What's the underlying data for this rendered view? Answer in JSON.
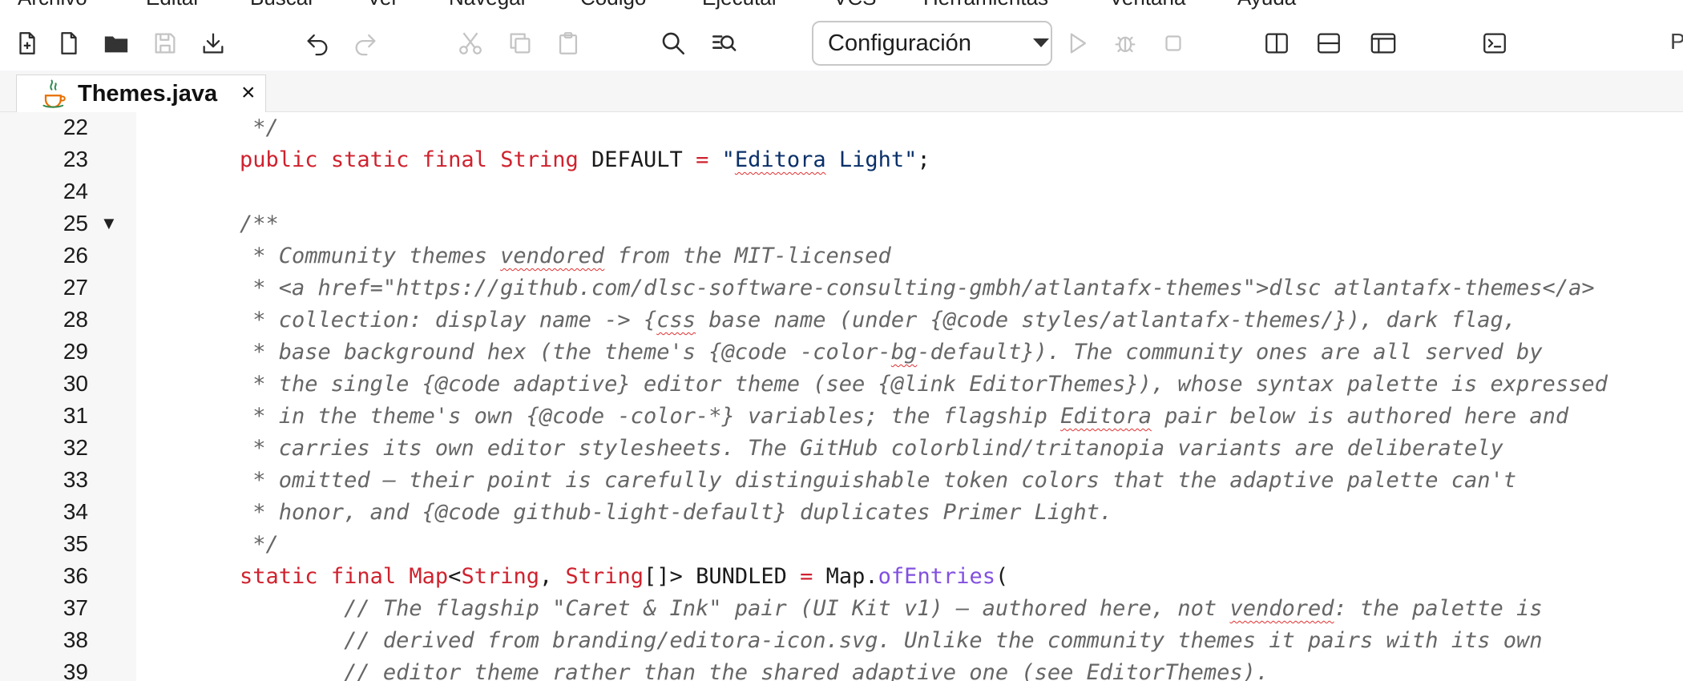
{
  "menubar": {
    "items": [
      "Archivo",
      "Editar",
      "Buscar",
      "Ver",
      "Navegar",
      "Código",
      "Ejecutar",
      "VCS",
      "Herramientas",
      "Ventana",
      "Ayuda"
    ]
  },
  "toolbar": {
    "buttons": [
      {
        "name": "new-file-icon",
        "enabled": true
      },
      {
        "name": "new-blank-file-icon",
        "enabled": true
      },
      {
        "name": "open-folder-icon",
        "enabled": true
      },
      {
        "name": "save-icon",
        "enabled": false
      },
      {
        "name": "download-icon",
        "enabled": true
      },
      {
        "name": "undo-icon",
        "enabled": true
      },
      {
        "name": "redo-icon",
        "enabled": false
      },
      {
        "name": "cut-icon",
        "enabled": false
      },
      {
        "name": "copy-icon",
        "enabled": false
      },
      {
        "name": "paste-icon",
        "enabled": false
      },
      {
        "name": "search-icon",
        "enabled": true
      },
      {
        "name": "search-replace-icon",
        "enabled": true
      },
      {
        "name": "run-icon",
        "enabled": false
      },
      {
        "name": "debug-icon",
        "enabled": false
      },
      {
        "name": "stop-icon",
        "enabled": false
      },
      {
        "name": "split-vertical-icon",
        "enabled": true
      },
      {
        "name": "split-horizontal-icon",
        "enabled": true
      },
      {
        "name": "layout-icon",
        "enabled": true
      },
      {
        "name": "terminal-icon",
        "enabled": true
      }
    ],
    "config_select": {
      "value": "Configuración"
    },
    "overflow_label": "P"
  },
  "tabs": [
    {
      "title": "Themes.java",
      "close": "×",
      "icon": "java-icon",
      "active": true
    }
  ],
  "editor": {
    "language": "java",
    "lines": [
      {
        "n": "22",
        "fold": "",
        "tokens": [
          {
            "t": "     */",
            "c": "cm"
          }
        ]
      },
      {
        "n": "23",
        "fold": "",
        "tokens": [
          {
            "t": "    ",
            "c": ""
          },
          {
            "t": "public",
            "c": "kw"
          },
          {
            "t": " ",
            "c": ""
          },
          {
            "t": "static",
            "c": "kw"
          },
          {
            "t": " ",
            "c": ""
          },
          {
            "t": "final",
            "c": "kw"
          },
          {
            "t": " ",
            "c": ""
          },
          {
            "t": "String",
            "c": "ty"
          },
          {
            "t": " DEFAULT ",
            "c": ""
          },
          {
            "t": "=",
            "c": "op"
          },
          {
            "t": " \"",
            "c": "str"
          },
          {
            "t": "Editora",
            "c": "str squig"
          },
          {
            "t": " Light\"",
            "c": "str"
          },
          {
            "t": ";",
            "c": ""
          }
        ]
      },
      {
        "n": "24",
        "fold": "",
        "tokens": []
      },
      {
        "n": "25",
        "fold": "▼",
        "tokens": [
          {
            "t": "    /**",
            "c": "cm"
          }
        ]
      },
      {
        "n": "26",
        "fold": "",
        "tokens": [
          {
            "t": "     * Community themes ",
            "c": "cm"
          },
          {
            "t": "vendored",
            "c": "cm squig"
          },
          {
            "t": " from the MIT-licensed",
            "c": "cm"
          }
        ]
      },
      {
        "n": "27",
        "fold": "",
        "tokens": [
          {
            "t": "     * <a href=\"https://github.com/dlsc-software-consulting-gmbh/atlantafx-themes\">dlsc atlantafx-themes</a>",
            "c": "cm"
          }
        ]
      },
      {
        "n": "28",
        "fold": "",
        "tokens": [
          {
            "t": "     * collection: display name -> {",
            "c": "cm"
          },
          {
            "t": "css",
            "c": "cm squig"
          },
          {
            "t": " base name (under {@code styles/atlantafx-themes/}), dark flag,",
            "c": "cm"
          }
        ]
      },
      {
        "n": "29",
        "fold": "",
        "tokens": [
          {
            "t": "     * base background hex (the theme's {@code -color-",
            "c": "cm"
          },
          {
            "t": "bg",
            "c": "cm squig"
          },
          {
            "t": "-default}). The community ones are all served by",
            "c": "cm"
          }
        ]
      },
      {
        "n": "30",
        "fold": "",
        "tokens": [
          {
            "t": "     * the single {@code adaptive} editor theme (see {@link EditorThemes}), whose syntax palette is expressed",
            "c": "cm"
          }
        ]
      },
      {
        "n": "31",
        "fold": "",
        "tokens": [
          {
            "t": "     * in the theme's own {@code -color-*} variables; the flagship ",
            "c": "cm"
          },
          {
            "t": "Editora",
            "c": "cm squig"
          },
          {
            "t": " pair below is authored here and",
            "c": "cm"
          }
        ]
      },
      {
        "n": "32",
        "fold": "",
        "tokens": [
          {
            "t": "     * carries its own editor stylesheets. The GitHub colorblind/tritanopia variants are deliberately",
            "c": "cm"
          }
        ]
      },
      {
        "n": "33",
        "fold": "",
        "tokens": [
          {
            "t": "     * omitted — their point is carefully distinguishable token colors that the adaptive palette can't",
            "c": "cm"
          }
        ]
      },
      {
        "n": "34",
        "fold": "",
        "tokens": [
          {
            "t": "     * honor, and {@code github-light-default} duplicates Primer Light.",
            "c": "cm"
          }
        ]
      },
      {
        "n": "35",
        "fold": "",
        "tokens": [
          {
            "t": "     */",
            "c": "cm"
          }
        ]
      },
      {
        "n": "36",
        "fold": "",
        "tokens": [
          {
            "t": "    ",
            "c": ""
          },
          {
            "t": "static",
            "c": "kw"
          },
          {
            "t": " ",
            "c": ""
          },
          {
            "t": "final",
            "c": "kw"
          },
          {
            "t": " ",
            "c": ""
          },
          {
            "t": "Map",
            "c": "ty"
          },
          {
            "t": "<",
            "c": ""
          },
          {
            "t": "String",
            "c": "ty"
          },
          {
            "t": ", ",
            "c": ""
          },
          {
            "t": "String",
            "c": "ty"
          },
          {
            "t": "[]> BUNDLED ",
            "c": ""
          },
          {
            "t": "=",
            "c": "op"
          },
          {
            "t": " Map.",
            "c": ""
          },
          {
            "t": "ofEntries",
            "c": "fn"
          },
          {
            "t": "(",
            "c": ""
          }
        ]
      },
      {
        "n": "37",
        "fold": "",
        "tokens": [
          {
            "t": "            // The flagship \"Caret & Ink\" pair (UI Kit v1) — authored here, not ",
            "c": "cm"
          },
          {
            "t": "vendored",
            "c": "cm squig"
          },
          {
            "t": ": the palette is",
            "c": "cm"
          }
        ]
      },
      {
        "n": "38",
        "fold": "",
        "tokens": [
          {
            "t": "            // derived from branding/editora-icon.svg. Unlike the community themes it pairs with its own",
            "c": "cm"
          }
        ]
      },
      {
        "n": "39",
        "fold": "",
        "tokens": [
          {
            "t": "            // editor theme rather than the shared adaptive one (see EditorThemes).",
            "c": "cm"
          }
        ]
      }
    ]
  },
  "colors": {
    "keyword": "#cf222e",
    "string": "#0a3069",
    "comment": "#666666",
    "function": "#8250df",
    "spellcheck": "#e03030",
    "java_icon_cup": "#e76f00",
    "java_icon_steam": "#2f8a4f"
  }
}
